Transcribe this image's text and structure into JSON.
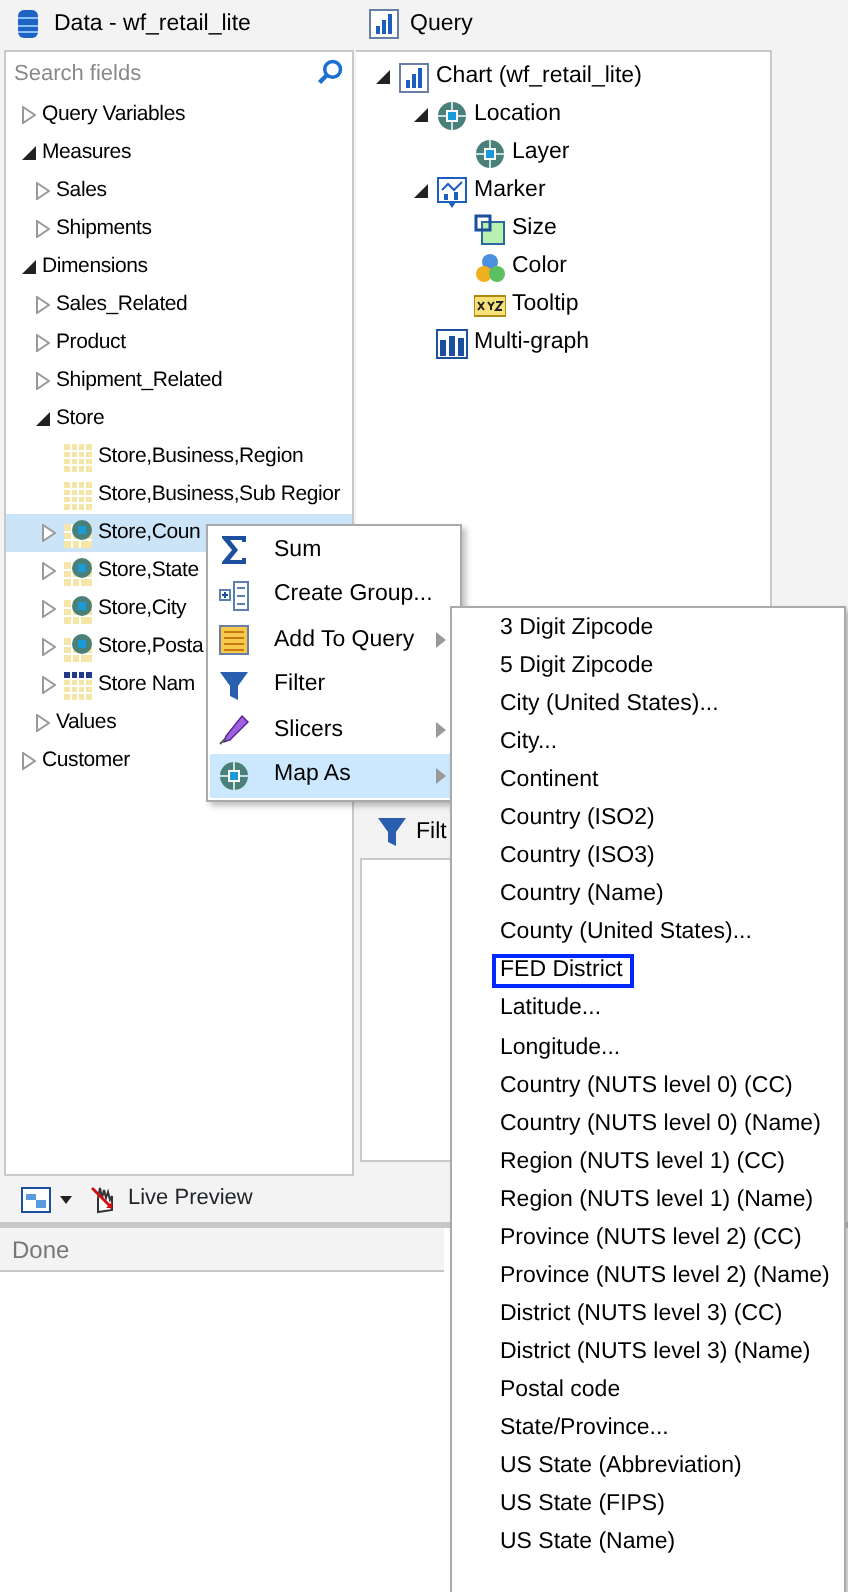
{
  "data_panel": {
    "title": "Data - wf_retail_lite",
    "search": {
      "placeholder": "Search fields"
    },
    "tree": [
      {
        "label": "Query Variables",
        "kind": "folder",
        "expanded": false,
        "selected": false
      },
      {
        "label": "Measures",
        "kind": "folder",
        "expanded": true,
        "selected": false,
        "children": [
          {
            "label": "Sales",
            "kind": "folder",
            "expanded": false,
            "selected": false
          },
          {
            "label": "Shipments",
            "kind": "folder",
            "expanded": false,
            "selected": false
          }
        ]
      },
      {
        "label": "Dimensions",
        "kind": "folder",
        "expanded": true,
        "selected": false,
        "children": [
          {
            "label": "Sales_Related",
            "kind": "folder",
            "expanded": false,
            "selected": false
          },
          {
            "label": "Product",
            "kind": "folder",
            "expanded": false,
            "selected": false
          },
          {
            "label": "Shipment_Related",
            "kind": "folder",
            "expanded": false,
            "selected": false
          },
          {
            "label": "Store",
            "kind": "folder",
            "expanded": true,
            "selected": false,
            "children": [
              {
                "label": "Store,Business,Region",
                "kind": "grid",
                "selected": false
              },
              {
                "label": "Store,Business,Sub Regior",
                "kind": "grid",
                "selected": false
              },
              {
                "label": "Store,Coun",
                "kind": "geo",
                "expanded": false,
                "selected": true
              },
              {
                "label": "Store,State",
                "kind": "geo",
                "expanded": false,
                "selected": false
              },
              {
                "label": "Store,City",
                "kind": "geo",
                "expanded": false,
                "selected": false
              },
              {
                "label": "Store,Posta",
                "kind": "geo",
                "expanded": false,
                "selected": false
              },
              {
                "label": "Store Nam",
                "kind": "dgrid",
                "expanded": false,
                "selected": false
              }
            ]
          },
          {
            "label": "Values",
            "kind": "folder",
            "expanded": false,
            "selected": false
          }
        ]
      },
      {
        "label": "Customer",
        "kind": "folder",
        "expanded": false,
        "selected": false
      }
    ]
  },
  "query_panel": {
    "title": "Query",
    "tree": [
      {
        "label": "Chart (wf_retail_lite)",
        "kind": "chart",
        "expanded": true,
        "children": [
          {
            "label": "Location",
            "kind": "globe",
            "expanded": true,
            "children": [
              {
                "label": "Layer",
                "kind": "globe"
              }
            ]
          },
          {
            "label": "Marker",
            "kind": "marker",
            "expanded": true,
            "children": [
              {
                "label": "Size",
                "kind": "size"
              },
              {
                "label": "Color",
                "kind": "color"
              },
              {
                "label": "Tooltip",
                "kind": "xyz"
              }
            ]
          },
          {
            "label": "Multi-graph",
            "kind": "multi"
          }
        ]
      }
    ],
    "filter": {
      "title": "Filt"
    }
  },
  "toolbar": {
    "live_preview": "Live Preview"
  },
  "status_bar": "Done",
  "context_menu": [
    {
      "label": "Sum",
      "kind": "sigma",
      "submenu": false,
      "selected": false
    },
    {
      "label": "Create Group...",
      "kind": "group",
      "submenu": false,
      "selected": false
    },
    {
      "label": "Add To Query",
      "kind": "list",
      "submenu": true,
      "selected": false
    },
    {
      "label": "Filter",
      "kind": "funnel",
      "submenu": false,
      "selected": false
    },
    {
      "label": "Slicers",
      "kind": "pen",
      "submenu": true,
      "selected": false
    },
    {
      "label": "Map As",
      "kind": "globe",
      "submenu": true,
      "selected": true
    }
  ],
  "map_as_menu": [
    {
      "label": "3 Digit Zipcode",
      "selected": false
    },
    {
      "label": "5 Digit Zipcode",
      "selected": false
    },
    {
      "label": "City (United States)...",
      "selected": false
    },
    {
      "label": "City...",
      "selected": false
    },
    {
      "label": "Continent",
      "selected": false
    },
    {
      "label": "Country (ISO2)",
      "selected": false
    },
    {
      "label": "Country (ISO3)",
      "selected": false
    },
    {
      "label": "Country (Name)",
      "selected": false
    },
    {
      "label": "County (United States)...",
      "selected": false
    },
    {
      "label": "FED District",
      "selected": true
    },
    {
      "label": "Latitude...",
      "selected": false
    },
    {
      "label": "Longitude...",
      "selected": false
    },
    {
      "label": "Country (NUTS level 0) (CC)",
      "selected": false
    },
    {
      "label": "Country (NUTS level 0) (Name)",
      "selected": false
    },
    {
      "label": "Region (NUTS level 1) (CC)",
      "selected": false
    },
    {
      "label": "Region (NUTS level 1) (Name)",
      "selected": false
    },
    {
      "label": "Province (NUTS level 2) (CC)",
      "selected": false
    },
    {
      "label": "Province (NUTS level 2) (Name)",
      "selected": false
    },
    {
      "label": "District (NUTS level 3) (CC)",
      "selected": false
    },
    {
      "label": "District (NUTS level 3) (Name)",
      "selected": false
    },
    {
      "label": "Postal code",
      "selected": false
    },
    {
      "label": "State/Province...",
      "selected": false
    },
    {
      "label": "US State (Abbreviation)",
      "selected": false
    },
    {
      "label": "US State (FIPS)",
      "selected": false
    },
    {
      "label": "US State (Name)",
      "selected": false
    }
  ]
}
